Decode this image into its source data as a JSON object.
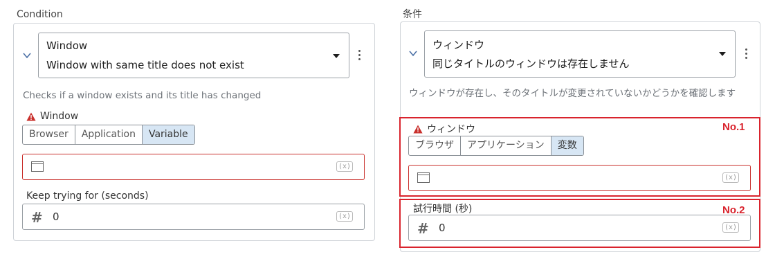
{
  "en": {
    "section_title": "Condition",
    "select_title": "Window",
    "select_subtitle": "Window with same title does not exist",
    "description": "Checks if a window exists and its title has changed",
    "window_label": "Window",
    "segments": [
      "Browser",
      "Application",
      "Variable"
    ],
    "active_segment": "Variable",
    "retry_label": "Keep trying for (seconds)",
    "retry_value": "0",
    "fx_label": "(x)"
  },
  "ja": {
    "section_title": "条件",
    "select_title": "ウィンドウ",
    "select_subtitle": "同じタイトルのウィンドウは存在しません",
    "description": "ウィンドウが存在し、そのタイトルが変更されていないかどうかを確認します",
    "window_label": "ウィンドウ",
    "segments": [
      "ブラウザ",
      "アプリケーション",
      "変数"
    ],
    "active_segment": "変数",
    "retry_label": "試行時間 (秒)",
    "retry_value": "0",
    "fx_label": "(x)"
  },
  "annotations": {
    "box1_label": "No.1",
    "box2_label": "No.2",
    "color": "#d9232d"
  },
  "icons": [
    "chevron-down-icon",
    "caret-down-icon",
    "kebab-menu-icon",
    "warning-icon",
    "window-icon",
    "hash-icon",
    "fx-icon"
  ]
}
